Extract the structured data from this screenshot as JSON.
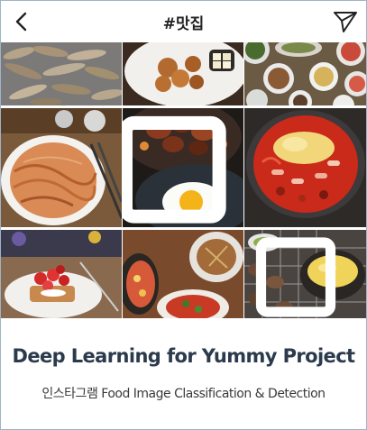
{
  "header": {
    "title": "#맛집",
    "back_icon": "chevron-left-icon",
    "send_icon": "paper-plane-icon"
  },
  "grid": {
    "tiles": [
      {
        "subject": "grilled small fish",
        "multi": false
      },
      {
        "subject": "fried chicken with pickled radish",
        "multi": false
      },
      {
        "subject": "korean side dishes",
        "multi": false
      },
      {
        "subject": "pancake with chopsticks",
        "multi": false
      },
      {
        "subject": "braised pork ribs and fried egg",
        "multi": true
      },
      {
        "subject": "spicy cheese tteokbokki",
        "multi": false
      },
      {
        "subject": "strawberry french toast",
        "multi": false
      },
      {
        "subject": "pizza and dishes",
        "multi": false
      },
      {
        "subject": "grilled clams and stew",
        "multi": true
      }
    ]
  },
  "caption": {
    "title": "Deep Learning for Yummy Project",
    "subtitle": "인스타그램 Food Image Classification & Detection"
  },
  "colors": {
    "frame_border": "#9db4c8",
    "title_text": "#2b3a4c"
  }
}
